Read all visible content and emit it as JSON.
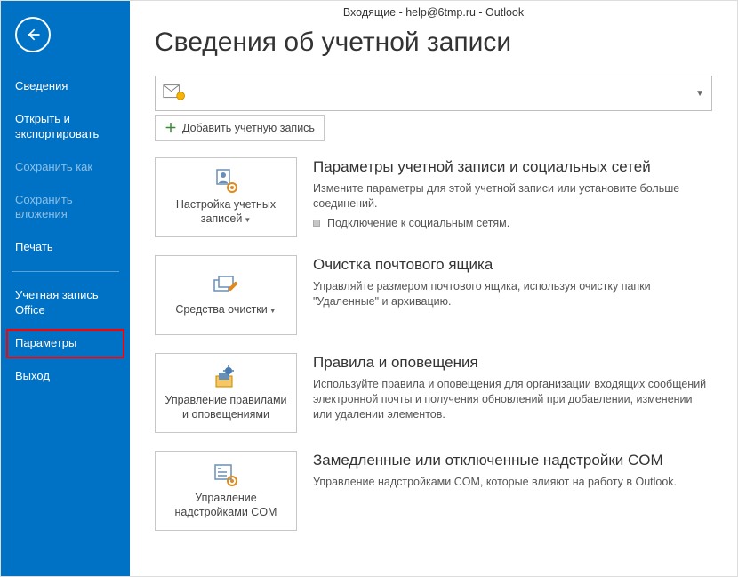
{
  "window_title": "Входящие - help@6tmp.ru - Outlook",
  "page_title": "Сведения об учетной записи",
  "nav": {
    "info": "Сведения",
    "openexport": "Открыть и экспортировать",
    "saveas": "Сохранить как",
    "saveattach": "Сохранить вложения",
    "print": "Печать",
    "office": "Учетная запись Office",
    "options": "Параметры",
    "exit": "Выход"
  },
  "add_account_label": "Добавить учетную запись",
  "tiles": {
    "settings": {
      "label": "Настройка учетных записей",
      "heading": "Параметры учетной записи и социальных сетей",
      "desc": "Измените параметры для этой учетной записи или установите больше соединений.",
      "sub": "Подключение к социальным сетям."
    },
    "cleanup": {
      "label": "Средства очистки",
      "heading": "Очистка почтового ящика",
      "desc": "Управляйте размером почтового ящика, используя очистку папки \"Удаленные\" и архивацию."
    },
    "rules": {
      "label": "Управление правилами и оповещениями",
      "heading": "Правила и оповещения",
      "desc": "Используйте правила и оповещения для организации входящих сообщений электронной почты и получения обновлений при добавлении, изменении или удалении элементов."
    },
    "com": {
      "label": "Управление надстройками COM",
      "heading": "Замедленные или отключенные надстройки COM",
      "desc": "Управление надстройками COM, которые влияют на работу в Outlook."
    }
  }
}
